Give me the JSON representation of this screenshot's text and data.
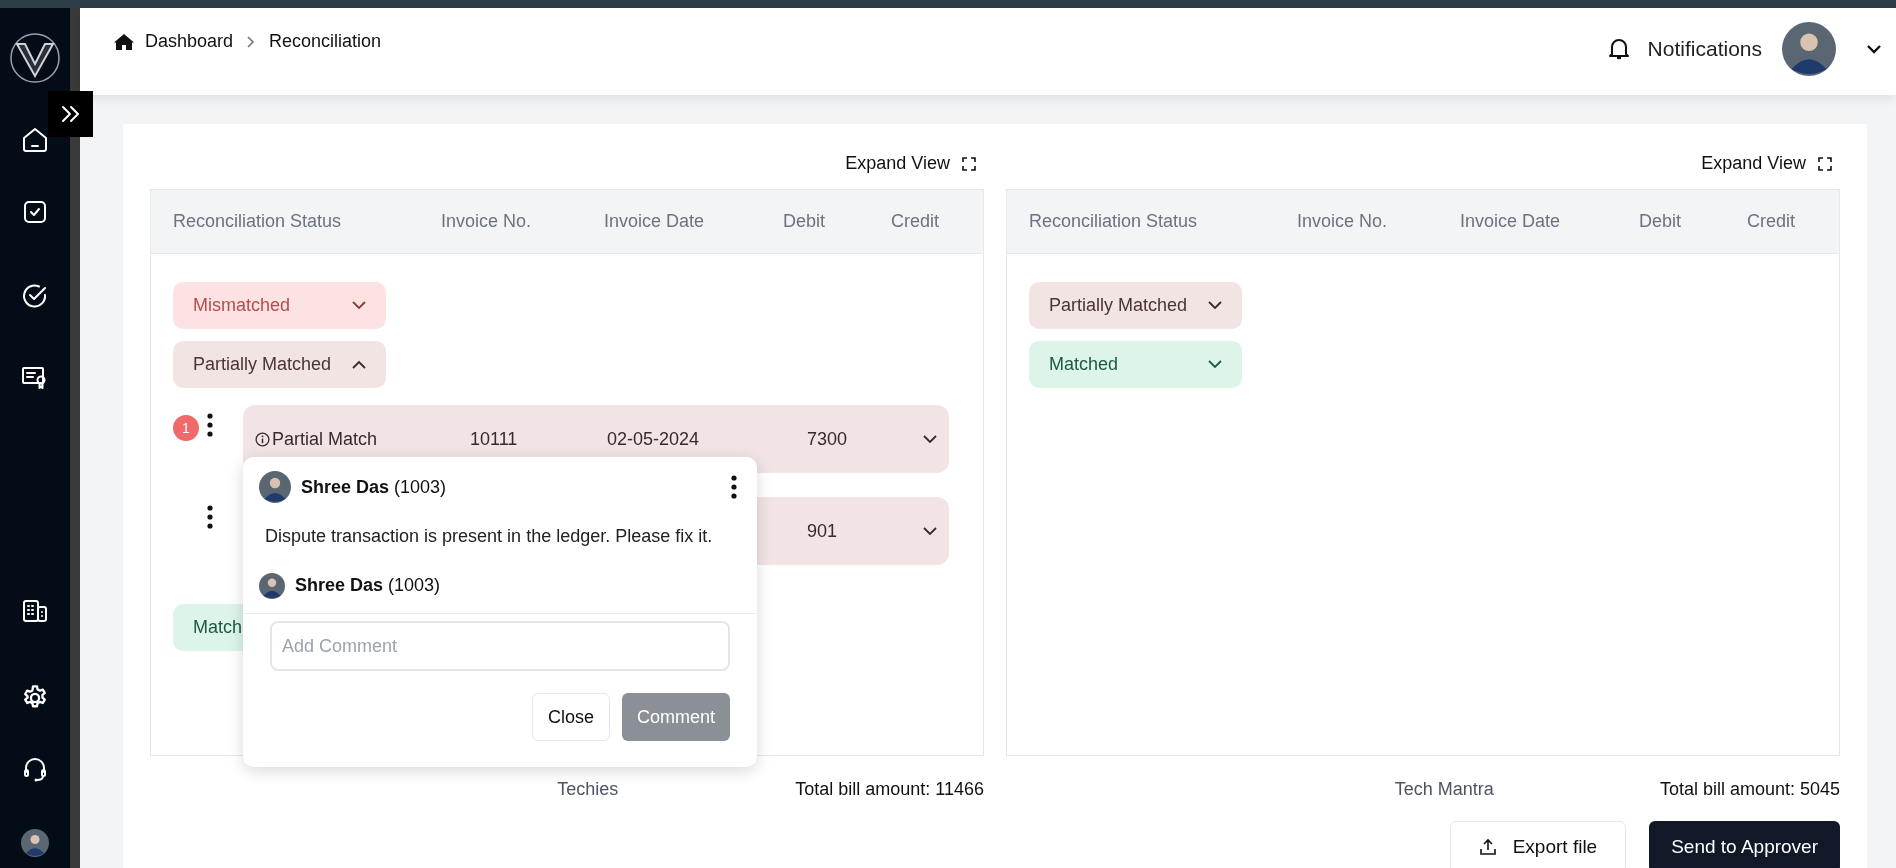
{
  "breadcrumb": [
    {
      "label": "Dashboard",
      "kind": "home"
    },
    {
      "label": "Reconciliation",
      "kind": "page"
    }
  ],
  "header": {
    "notifications": "Notifications"
  },
  "panels": [
    {
      "expand_label": "Expand View",
      "columns": [
        "Reconciliation Status",
        "Invoice No.",
        "Invoice Date",
        "Debit",
        "Credit"
      ],
      "groups": [
        {
          "label": "Mismatched",
          "kind": "mismatched",
          "expanded": false
        },
        {
          "label": "Partially Matched",
          "kind": "partial",
          "expanded": true,
          "rows": [
            {
              "badge": "1",
              "status": "Partial Match",
              "invoice_no": "10111",
              "invoice_date": "02-05-2024",
              "debit": "7300",
              "expanded": false
            },
            {
              "debit": "901",
              "expanded": false
            }
          ]
        },
        {
          "label": "Match",
          "kind": "matched"
        }
      ],
      "party": "Techies",
      "total": "Total bill amount: 11466"
    },
    {
      "expand_label": "Expand View",
      "columns": [
        "Reconciliation Status",
        "Invoice No.",
        "Invoice Date",
        "Debit",
        "Credit"
      ],
      "groups": [
        {
          "label": "Partially Matched",
          "kind": "partial",
          "expanded": false
        },
        {
          "label": "Matched",
          "kind": "matched",
          "expanded": false
        }
      ],
      "party": "Tech Mantra",
      "total": "Total bill amount: 5045"
    }
  ],
  "comment_popup": {
    "comments": [
      {
        "author": "**Shree Das** (1003)",
        "text": "Dispute transaction is present in the ledger. Please fix it."
      }
    ],
    "reply_author": "**Shree Das** (1003)",
    "input": {
      "placeholder": "Add Comment"
    },
    "buttons": [
      {
        "label": "Close",
        "disabled": false,
        "kind": "secondary"
      },
      {
        "label": "Comment",
        "disabled": true,
        "kind": "primary"
      }
    ]
  },
  "actions": [
    {
      "label": "Export file",
      "kind": "export"
    },
    {
      "label": "Send to Approver",
      "kind": "primary"
    }
  ]
}
